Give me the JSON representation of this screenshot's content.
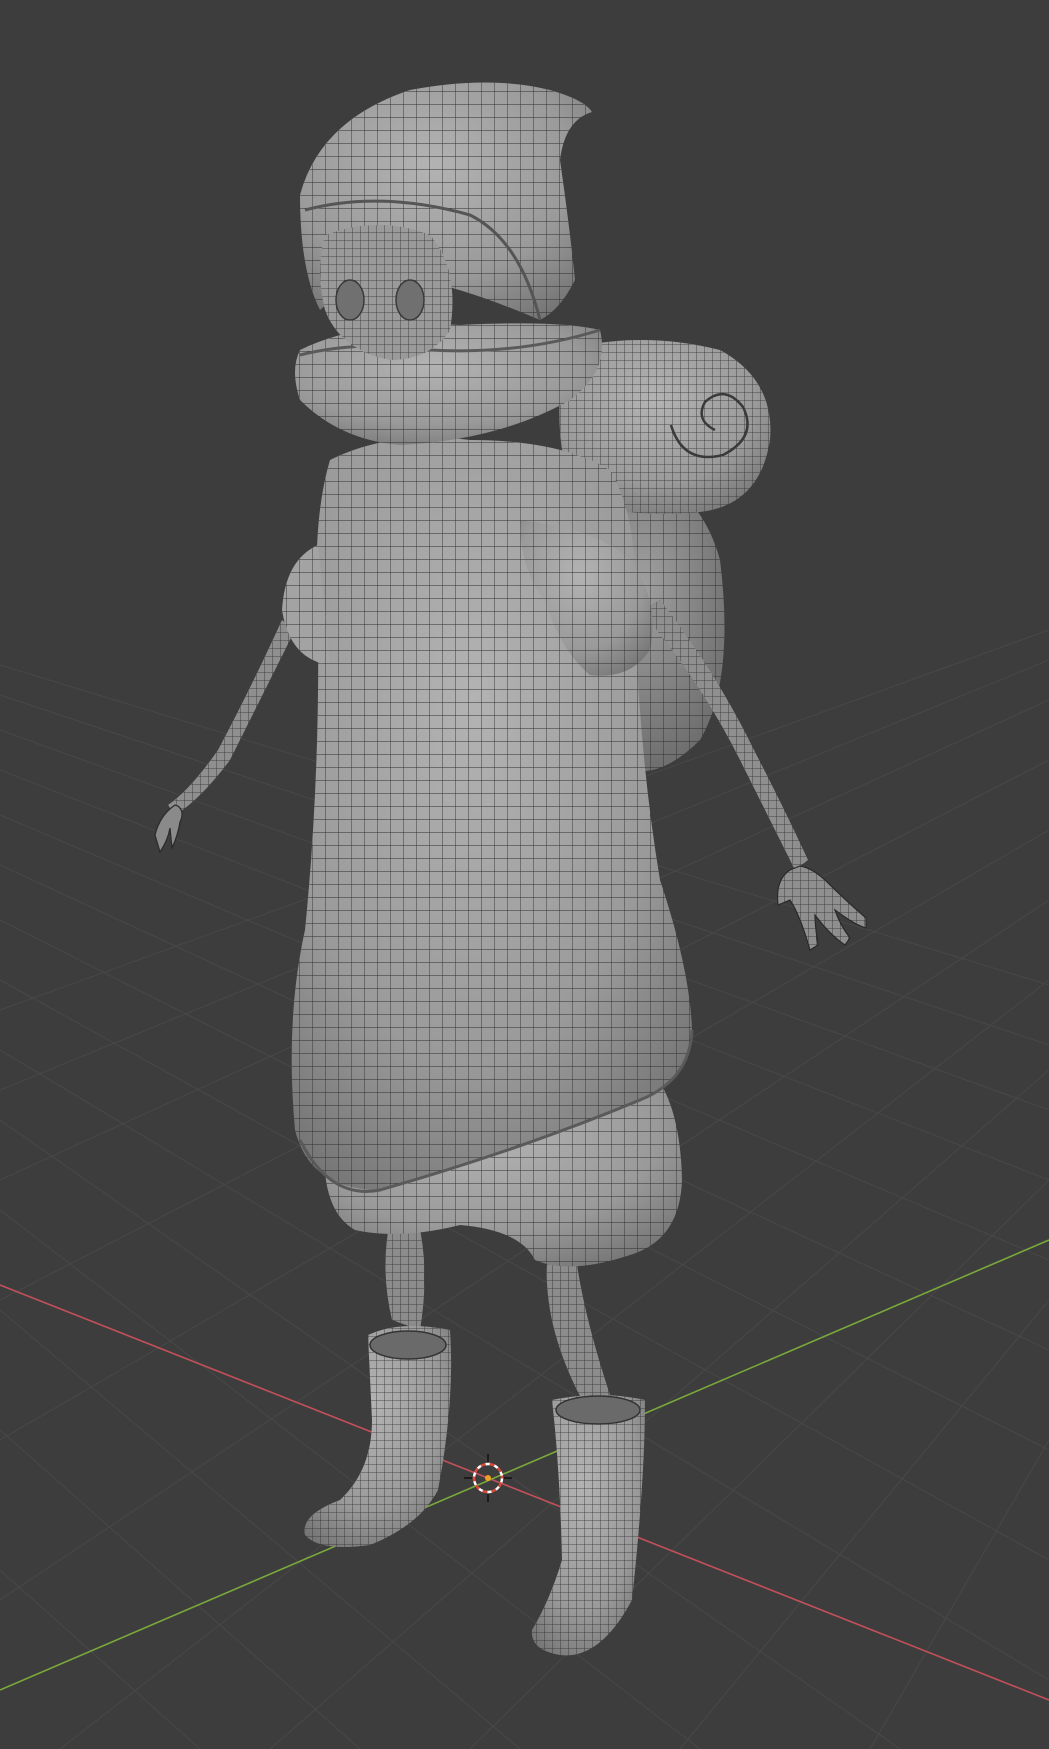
{
  "viewport": {
    "mode": "3D Viewport",
    "shading": "solid-wireframe",
    "background_color": "#3d3d3d",
    "grid_color": "#4a4a4a",
    "x_axis_color": "#c2505a",
    "y_axis_color": "#7aa83b",
    "mesh_color": "#9c9c9c",
    "wire_color": "#2a2a2a"
  },
  "scene": {
    "object": "hooded-character-mesh",
    "parts": [
      "hood",
      "face-mask",
      "collar",
      "coat",
      "backpack",
      "bedroll",
      "left-arm",
      "right-arm",
      "left-hand",
      "right-hand",
      "shorts",
      "left-leg",
      "right-leg",
      "left-boot",
      "right-boot"
    ],
    "cursor": "3d-cursor-icon"
  }
}
